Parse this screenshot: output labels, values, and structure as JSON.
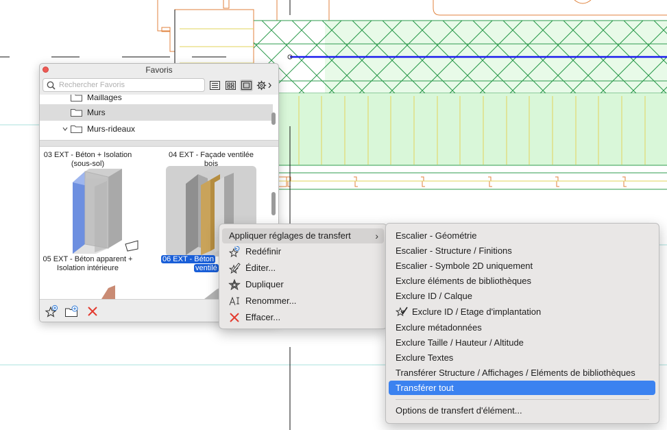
{
  "palette": {
    "title": "Favoris",
    "search_placeholder": "Rechercher Favoris",
    "tree": [
      {
        "label": "Maillages",
        "selected": false,
        "expanded": false
      },
      {
        "label": "Murs",
        "selected": true,
        "expanded": false
      },
      {
        "label": "Murs-rideaux",
        "selected": false,
        "expanded": true
      }
    ],
    "items": [
      {
        "caption_line1": "03 EXT - Béton + Isolation",
        "caption_line2": "(sous-sol)"
      },
      {
        "caption_line1": "04 EXT - Façade ventilée",
        "caption_line2": "bois"
      },
      {
        "caption_line1": "05 EXT - Béton apparent +",
        "caption_line2": "Isolation intérieure"
      },
      {
        "caption_line1": "06 EXT - Béton",
        "caption_line2": "ventilé",
        "selected": true
      }
    ]
  },
  "context_menu": {
    "items": [
      {
        "label": "Appliquer réglages de transfert",
        "has_submenu": true,
        "icon": "none"
      },
      {
        "label": "Redéfinir",
        "icon": "star-redefine-icon"
      },
      {
        "label": "Éditer...",
        "icon": "star-edit-icon"
      },
      {
        "label": "Dupliquer",
        "icon": "star-duplicate-icon"
      },
      {
        "label": "Renommer...",
        "icon": "rename-icon"
      },
      {
        "label": "Effacer...",
        "icon": "delete-x-icon"
      }
    ]
  },
  "submenu": {
    "items": [
      {
        "label": "Escalier - Géométrie"
      },
      {
        "label": "Escalier - Structure / Finitions"
      },
      {
        "label": "Escalier - Symbole 2D uniquement"
      },
      {
        "label": "Exclure éléments de bibliothèques"
      },
      {
        "label": "Exclure ID / Calque"
      },
      {
        "label": "Exclure ID / Etage d'implantation",
        "checked": true
      },
      {
        "label": "Exclure métadonnées"
      },
      {
        "label": "Exclure Taille / Hauteur / Altitude"
      },
      {
        "label": "Exclure Textes"
      },
      {
        "label": "Transférer Structure / Affichages / Eléments de bibliothèques"
      },
      {
        "label": "Transférer tout",
        "active": true
      }
    ],
    "footer_item": "Options de transfert d'élément..."
  },
  "colors": {
    "accent": "#3b82f0",
    "selection_blue": "#1a5fd8",
    "hatch_green": "#2e9b4e",
    "fill_green": "#d9f7d9",
    "wall_line_blue": "#1a1aee",
    "orange_line": "#e0823c",
    "yellow_line": "#e2d35a"
  }
}
